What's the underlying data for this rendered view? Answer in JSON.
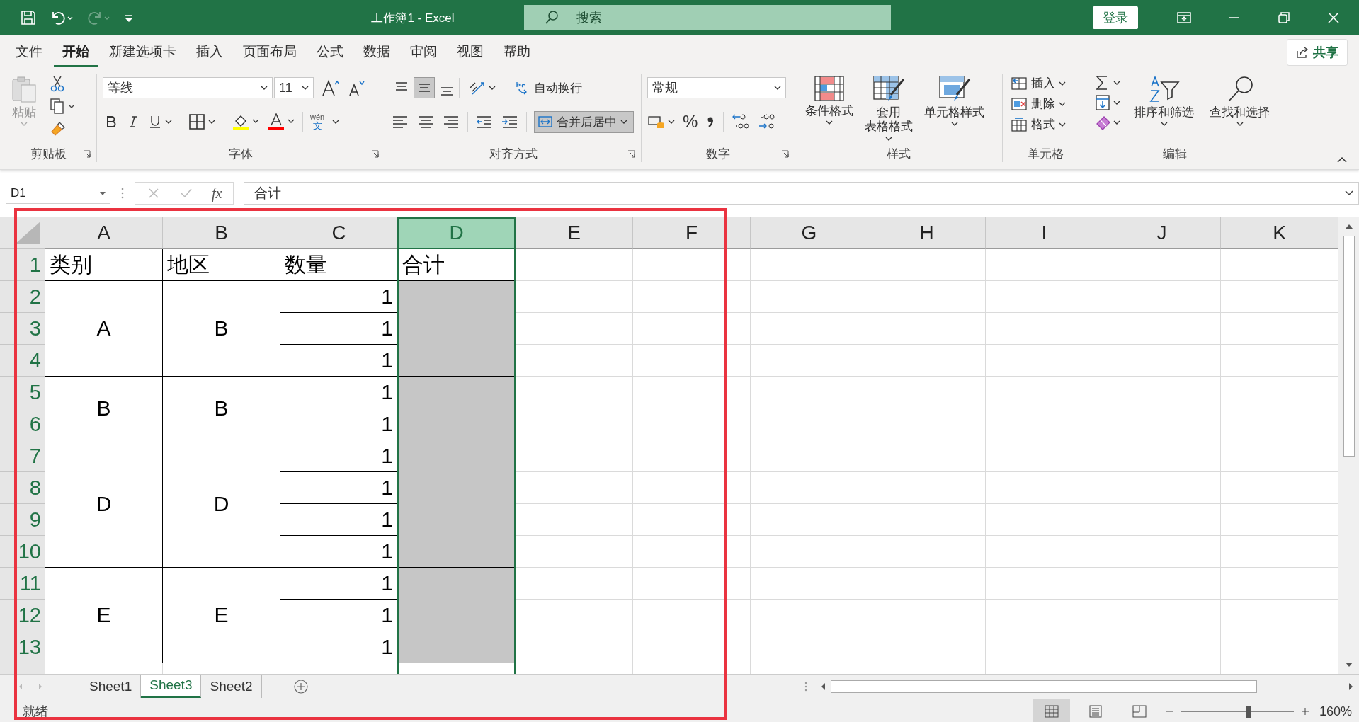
{
  "title_bar": {
    "title": "工作簿1  -  Excel",
    "search_placeholder": "搜索",
    "sign_in": "登录"
  },
  "menu_tabs": [
    {
      "label": "文件",
      "selected": false
    },
    {
      "label": "开始",
      "selected": true
    },
    {
      "label": "新建选项卡",
      "selected": false
    },
    {
      "label": "插入",
      "selected": false
    },
    {
      "label": "页面布局",
      "selected": false
    },
    {
      "label": "公式",
      "selected": false
    },
    {
      "label": "数据",
      "selected": false
    },
    {
      "label": "审阅",
      "selected": false
    },
    {
      "label": "视图",
      "selected": false
    },
    {
      "label": "帮助",
      "selected": false
    }
  ],
  "share": "共享",
  "ribbon": {
    "clipboard": {
      "label": "剪贴板",
      "paste": "粘贴"
    },
    "font": {
      "label": "字体",
      "font_name": "等线",
      "font_size": "11",
      "phonetic_top": "wén",
      "phonetic_bottom": "文"
    },
    "alignment": {
      "label": "对齐方式",
      "vertical_align": [
        {
          "kind": "top",
          "selected": false
        },
        {
          "kind": "middle",
          "selected": true
        },
        {
          "kind": "bottom",
          "selected": false
        }
      ],
      "wrap_text": "自动换行",
      "merge_center": {
        "label": "合并后居中",
        "on": true
      }
    },
    "number": {
      "label": "数字",
      "format": "常规",
      "percent": "%"
    },
    "styles": {
      "label": "样式",
      "buttons": [
        {
          "kind": "conditional",
          "lines": [
            "条件格式"
          ]
        },
        {
          "kind": "table",
          "lines": [
            "套用",
            "表格格式"
          ]
        },
        {
          "kind": "cell",
          "lines": [
            "单元格样式"
          ]
        }
      ]
    },
    "cells": {
      "label": "单元格",
      "buttons": [
        {
          "kind": "insert",
          "label": "插入"
        },
        {
          "kind": "delete",
          "label": "删除"
        },
        {
          "kind": "format",
          "label": "格式"
        }
      ]
    },
    "editing": {
      "label": "编辑",
      "sort_filter": "排序和筛选",
      "find_select": "查找和选择"
    }
  },
  "formula_bar": {
    "name_box": "D1",
    "fx": "fx",
    "value": "合计"
  },
  "columns": [
    {
      "label": "A",
      "selected": false
    },
    {
      "label": "B",
      "selected": false
    },
    {
      "label": "C",
      "selected": false
    },
    {
      "label": "D",
      "selected": true
    },
    {
      "label": "E",
      "selected": false
    },
    {
      "label": "F",
      "selected": false
    },
    {
      "label": "G",
      "selected": false
    },
    {
      "label": "H",
      "selected": false
    },
    {
      "label": "I",
      "selected": false
    },
    {
      "label": "J",
      "selected": false
    },
    {
      "label": "K",
      "selected": false
    }
  ],
  "rows": [
    "1",
    "2",
    "3",
    "4",
    "5",
    "6",
    "7",
    "8",
    "9",
    "10",
    "11",
    "12",
    "13"
  ],
  "table": {
    "header": [
      "类别",
      "地区",
      "数量",
      "合计"
    ],
    "groups": [
      {
        "category": "A",
        "region": "B",
        "quantities": [
          "1",
          "1",
          "1"
        ],
        "total_selected": true
      },
      {
        "category": "B",
        "region": "B",
        "quantities": [
          "1",
          "1"
        ],
        "total_selected": true
      },
      {
        "category": "D",
        "region": "D",
        "quantities": [
          "1",
          "1",
          "1",
          "1"
        ],
        "total_selected": true
      },
      {
        "category": "E",
        "region": "E",
        "quantities": [
          "1",
          "1",
          "1"
        ],
        "total_selected": true
      }
    ]
  },
  "sheet_tabs": [
    {
      "label": "Sheet1",
      "selected": false
    },
    {
      "label": "Sheet3",
      "selected": true
    },
    {
      "label": "Sheet2",
      "selected": false
    }
  ],
  "status_bar": {
    "status": "就绪",
    "views": [
      {
        "kind": "normal",
        "selected": true
      },
      {
        "kind": "layout",
        "selected": false
      },
      {
        "kind": "break",
        "selected": false
      }
    ],
    "zoom": {
      "level": 0.6
    },
    "zoom_reading": "160%"
  }
}
